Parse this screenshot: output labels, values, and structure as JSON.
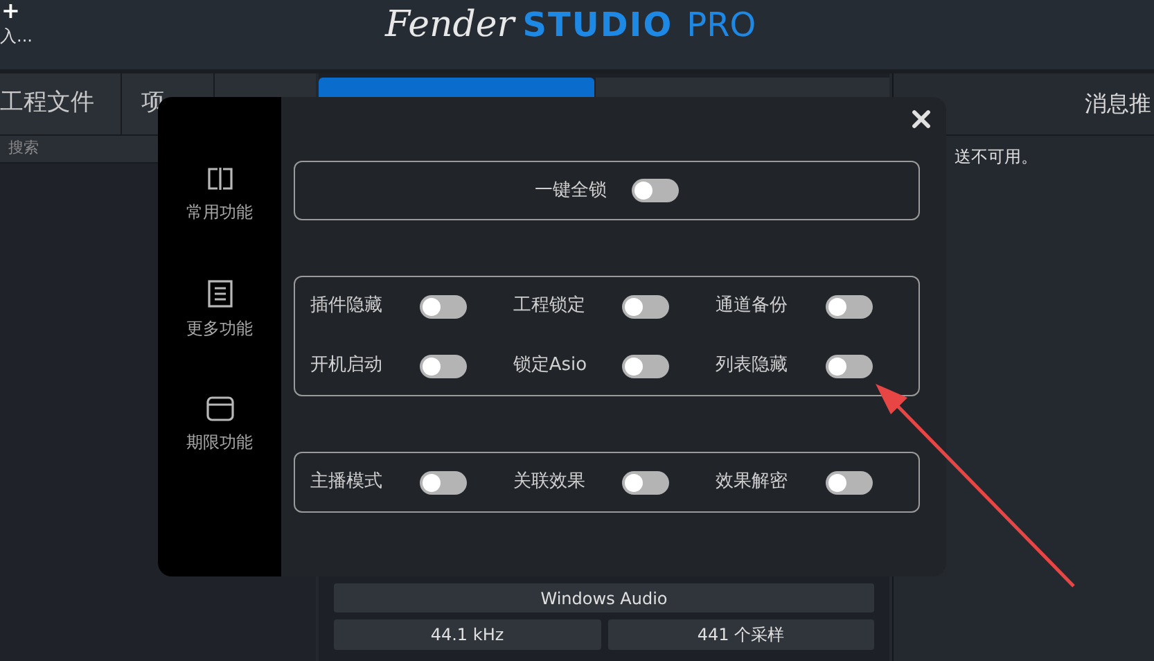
{
  "header": {
    "add": "+",
    "project": "入...",
    "logo": {
      "brand": "Fender",
      "product": "STUDIO",
      "suffix": "PRO"
    }
  },
  "tabs": [
    {
      "label": "工程文件",
      "selected": false
    },
    {
      "label": "项",
      "selected": false
    }
  ],
  "search": {
    "placeholder": "搜索"
  },
  "messages": {
    "title": "消息推",
    "text": "送不可用。"
  },
  "audio": {
    "device": "Windows Audio",
    "sample_rate": "44.1 kHz",
    "buffer": "441 个采样"
  },
  "dialog": {
    "nav": [
      {
        "label": "常用功能",
        "kind": "common"
      },
      {
        "label": "更多功能",
        "kind": "more"
      },
      {
        "label": "期限功能",
        "kind": "limited"
      }
    ],
    "groups": [
      {
        "kind": "single",
        "toggles": [
          {
            "label": "一键全锁",
            "on": false
          }
        ]
      },
      {
        "kind": "grid",
        "toggles": [
          {
            "label": "插件隐藏",
            "on": false
          },
          {
            "label": "工程锁定",
            "on": false
          },
          {
            "label": "通道备份",
            "on": false
          },
          {
            "label": "开机启动",
            "on": false
          },
          {
            "label": "锁定Asio",
            "on": false
          },
          {
            "label": "列表隐藏",
            "on": false
          }
        ]
      },
      {
        "kind": "grid",
        "toggles": [
          {
            "label": "主播模式",
            "on": false
          },
          {
            "label": "关联效果",
            "on": false
          },
          {
            "label": "效果解密",
            "on": false
          }
        ]
      }
    ]
  }
}
